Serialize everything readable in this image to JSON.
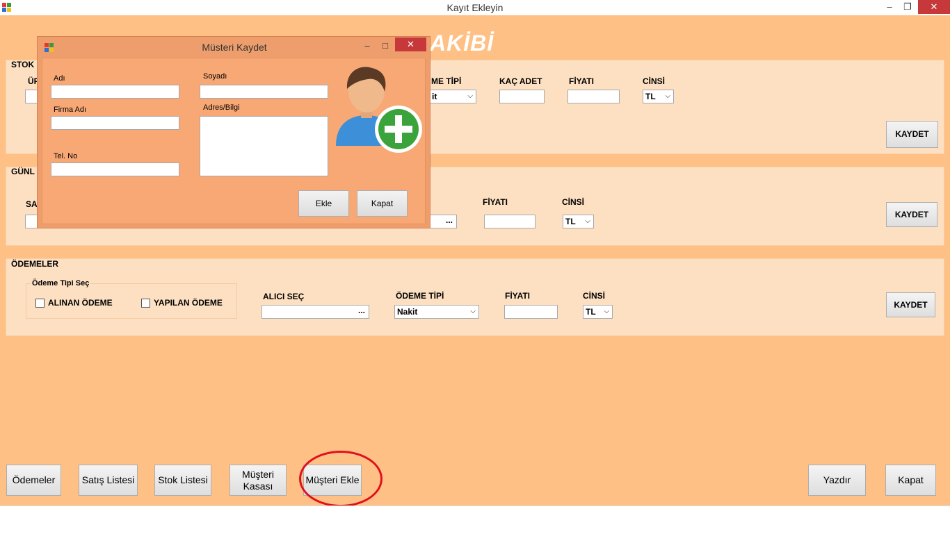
{
  "window": {
    "title": "Kayıt Ekleyin",
    "minimize": "–",
    "restore": "❐",
    "close": "✕"
  },
  "banner": {
    "text": "AKİBİ"
  },
  "stock": {
    "title": "STOK",
    "partial_label": "ÜF",
    "payment_type_label": "ME TİPİ",
    "payment_type_value": "it",
    "qty_label": "KAÇ ADET",
    "price_label": "FİYATI",
    "currency_label": "CİNSİ",
    "currency_value": "TL",
    "save": "KAYDET"
  },
  "daily": {
    "title": "GÜNL",
    "partial_label": "SA",
    "dots": "...",
    "price_label": "FİYATI",
    "currency_label": "CİNSİ",
    "currency_value": "TL",
    "save": "KAYDET"
  },
  "payments": {
    "title": "ÖDEMELER",
    "group_title": "Ödeme Tipi Seç",
    "received": "ALINAN ÖDEME",
    "made": "YAPILAN ÖDEME",
    "receiver_label": "ALICI SEÇ",
    "dots": "...",
    "payment_type_label": "ÖDEME TİPİ",
    "payment_type_value": "Nakit",
    "price_label": "FİYATI",
    "currency_label": "CİNSİ",
    "currency_value": "TL",
    "save": "KAYDET"
  },
  "bottom": {
    "odemeler": "Ödemeler",
    "satis": "Satış Listesi",
    "stok": "Stok Listesi",
    "kasa": "Müşteri Kasası",
    "ekle": "Müşteri Ekle",
    "yazdir": "Yazdır",
    "kapat": "Kapat"
  },
  "dialog": {
    "title": "Müsteri Kaydet",
    "minimize": "–",
    "maximize": "□",
    "close": "✕",
    "name_label": "Adı",
    "surname_label": "Soyadı",
    "company_label": "Firma Adı",
    "address_label": "Adres/Bilgi",
    "phone_label": "Tel. No",
    "add": "Ekle",
    "close_btn": "Kapat"
  },
  "colors": {
    "background": "#ffc085",
    "panel": "#fde0c2",
    "dialog": "#f8a875",
    "highlight": "#e0101e"
  }
}
